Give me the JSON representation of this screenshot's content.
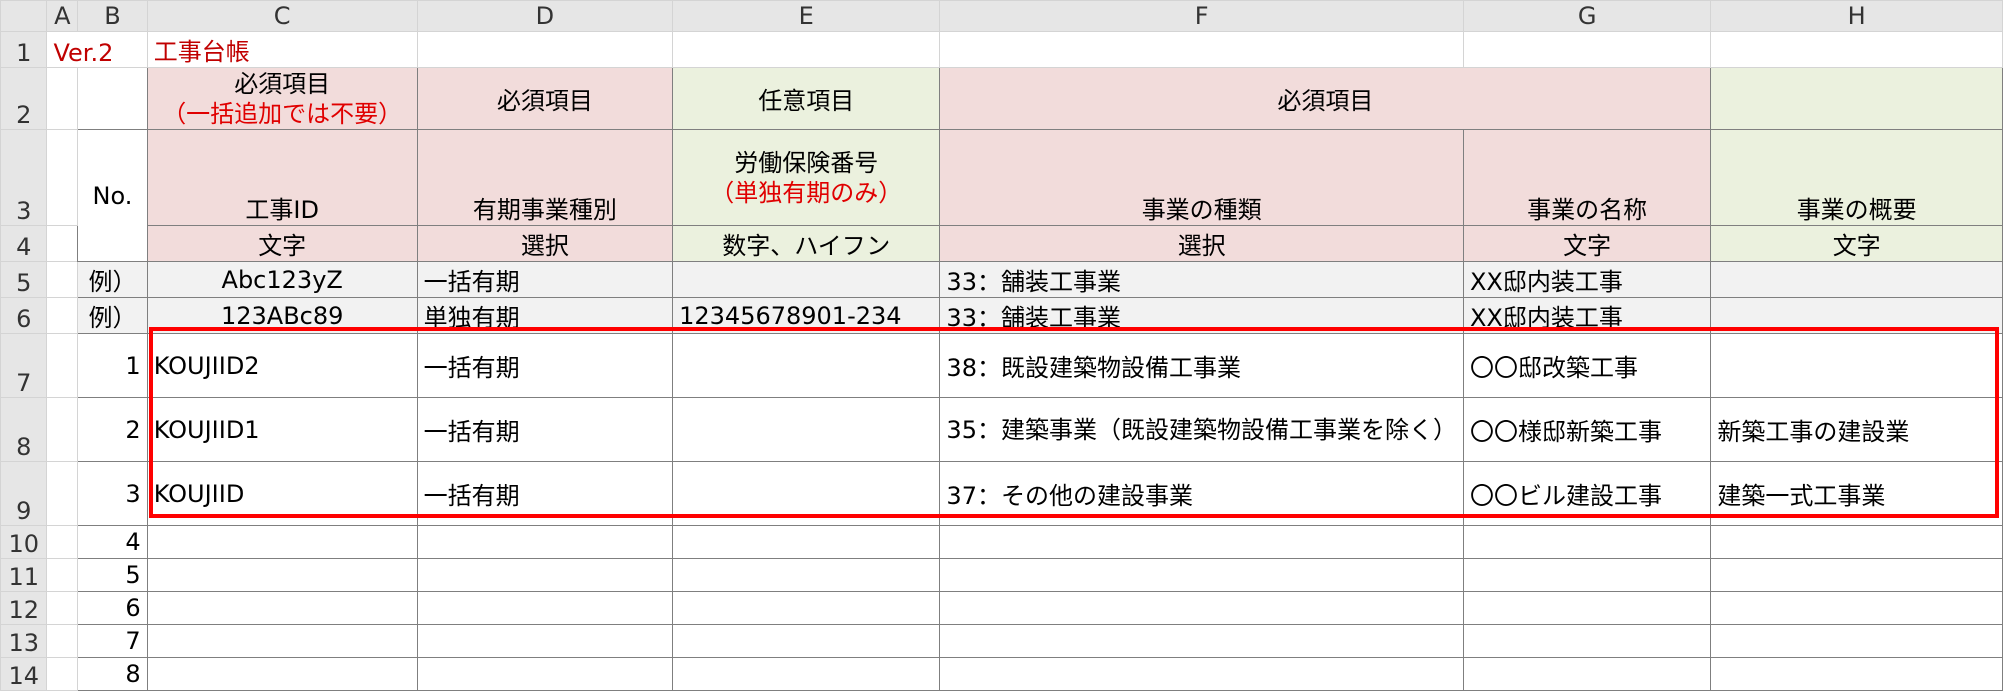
{
  "columns": [
    "A",
    "B",
    "C",
    "D",
    "E",
    "F",
    "G",
    "H"
  ],
  "row_numbers": [
    "1",
    "2",
    "3",
    "4",
    "5",
    "6",
    "7",
    "8",
    "9",
    "10",
    "11",
    "12",
    "13",
    "14"
  ],
  "title": {
    "version": "Ver.2",
    "name": "工事台帳"
  },
  "headers": {
    "c_req": "必須項目",
    "c_req_note": "（一括追加では不要）",
    "d_req": "必須項目",
    "e_opt": "任意項目",
    "fg_req": "必須項目",
    "no": "No.",
    "c_field": "工事ID",
    "d_field": "有期事業種別",
    "e_field": "労働保険番号",
    "e_field_note": "（単独有期のみ）",
    "f_field": "事業の種類",
    "g_field": "事業の名称",
    "h_field": "事業の概要"
  },
  "types": {
    "c": "文字",
    "d": "選択",
    "e": "数字、ハイフン",
    "f": "選択",
    "g": "文字",
    "h": "文字"
  },
  "examples": [
    {
      "no": "例）",
      "id": "Abc123yZ",
      "kind": "一括有期",
      "insurance": "",
      "type": "33：舗装工事業",
      "name": "XX邸内装工事",
      "summary": ""
    },
    {
      "no": "例）",
      "id": "123ABc89",
      "kind": "単独有期",
      "insurance": "12345678901-234",
      "type": "33：舗装工事業",
      "name": "XX邸内装工事",
      "summary": ""
    }
  ],
  "rows": [
    {
      "no": "1",
      "id": "KOUJIID2",
      "kind": "一括有期",
      "insurance": "",
      "type": "38：既設建築物設備工事業",
      "name": "〇〇邸改築工事",
      "summary": ""
    },
    {
      "no": "2",
      "id": "KOUJIID1",
      "kind": "一括有期",
      "insurance": "",
      "type": "35：建築事業（既設建築物設備工事業を除く）",
      "name": "〇〇様邸新築工事",
      "summary": "新築工事の建設業"
    },
    {
      "no": "3",
      "id": "KOUJIID",
      "kind": "一括有期",
      "insurance": "",
      "type": "37：その他の建設事業",
      "name": "〇〇ビル建設工事",
      "summary": "建築一式工事業"
    }
  ],
  "empty_rows": [
    "4",
    "5",
    "6",
    "7",
    "8"
  ],
  "colors": {
    "required": "#f2dcdb",
    "optional": "#ebf1de",
    "highlight_box": "#ff0000",
    "title_text": "#c00000"
  }
}
